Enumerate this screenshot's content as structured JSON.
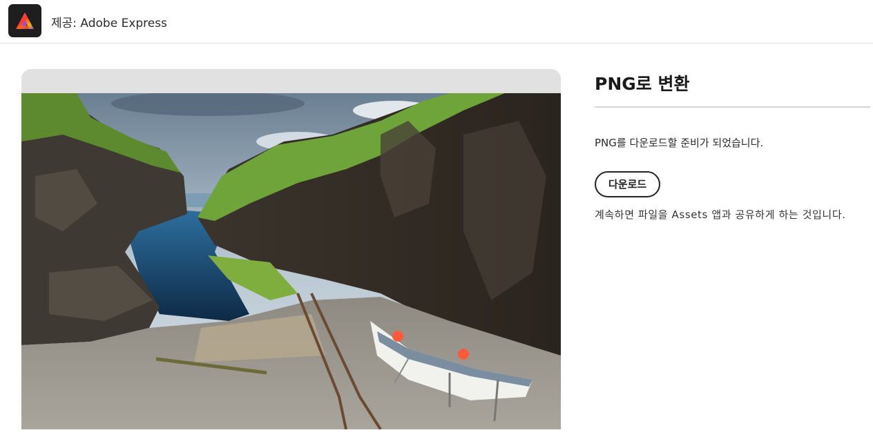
{
  "header": {
    "logo_icon": "adobe-express-logo-icon",
    "provider_text": "제공: Adobe Express"
  },
  "preview": {
    "image_description_icon": "photo-fjord-boat"
  },
  "panel": {
    "title": "PNG로 변환",
    "status": "PNG를 다운로드할 준비가 되었습니다.",
    "download_label": "다운로드",
    "notice": "계속하면 파일을 Assets 앱과 공유하게 하는 것입니다."
  },
  "colors": {
    "logo_bg": "#1e1e1e",
    "preview_bg": "#e1e1e1",
    "divider": "#d5d5d5"
  }
}
